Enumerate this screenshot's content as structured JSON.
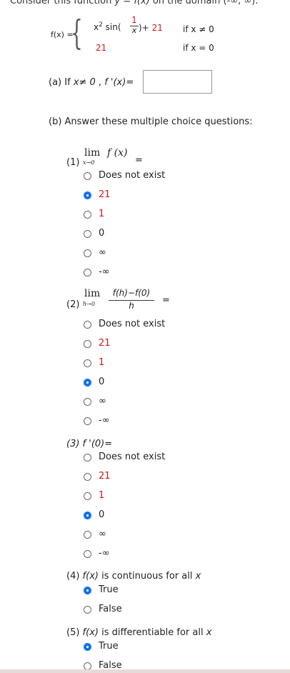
{
  "header": {
    "prefix": "Consider this function ",
    "y_eq": "y = f(x)",
    "mid": " on the domain ",
    "domain": "(-∞, ∞)."
  },
  "piecewise": {
    "lhs": "f(x) =",
    "case1_expr_a": "x",
    "case1_exp": "2",
    "case1_expr_b": " sin(",
    "frac_num": "1",
    "frac_den": "x",
    "case1_expr_c": ")+ ",
    "case1_const": "21",
    "case1_cond": "if x ≠ 0",
    "case2_val": "21",
    "case2_cond": "if x = 0"
  },
  "part_a": {
    "label_a": "(a) If ",
    "label_b": "x≠ 0",
    "label_c": " , ",
    "label_d": "f '(x)=",
    "answer_value": ""
  },
  "part_b": {
    "heading": "(b) Answer these multiple choice questions:"
  },
  "q1": {
    "num": "(1)",
    "lim": "lim",
    "sub": "x→0",
    "expr": "f (x)",
    "eq": "="
  },
  "q2": {
    "num": "(2)",
    "lim": "lim",
    "sub": "h→0",
    "num_expr": "f(h)−f(0)",
    "den_expr": "h",
    "eq": "="
  },
  "q3": {
    "label": "(3) f '(0)="
  },
  "q4": {
    "label_a": "(4) ",
    "label_b": "f(x)",
    "label_c": " is continuous for all ",
    "label_d": "x"
  },
  "q5": {
    "label_a": "(5) ",
    "label_b": "f(x)",
    "label_c": " is differentiable for all ",
    "label_d": "x"
  },
  "options": {
    "dne": "Does not exist",
    "v21": "21",
    "v1": "1",
    "v0": "0",
    "inf": "∞",
    "neginf": "-∞",
    "true": "True",
    "false": "False"
  },
  "selected": {
    "q1": "21",
    "q2": "0",
    "q3": "0",
    "q4": "True",
    "q5": "True"
  },
  "colors": {
    "accent": "#1473e6",
    "red_text": "#d0191c"
  }
}
